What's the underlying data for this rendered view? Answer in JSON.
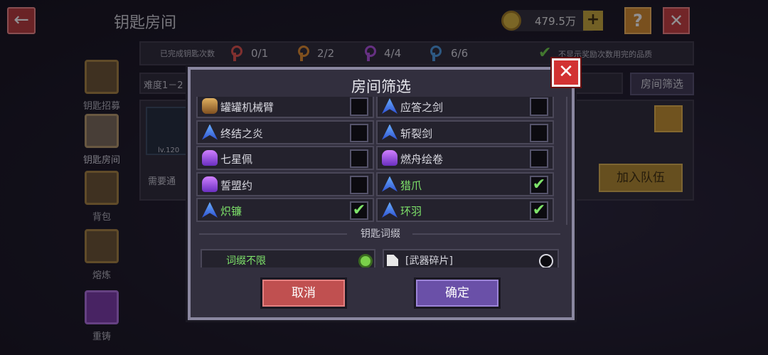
{
  "header": {
    "title": "钥匙房间",
    "currency": "479.5万"
  },
  "stats": {
    "completed_label": "已完成钥匙次数",
    "keys": [
      {
        "count": "0/1",
        "color": "#e0504a"
      },
      {
        "count": "2/2",
        "color": "#e08a2a"
      },
      {
        "count": "4/4",
        "color": "#b050e0"
      },
      {
        "count": "6/6",
        "color": "#4a9ae0"
      }
    ],
    "quality_label": "不显示奖励次数用完的品质"
  },
  "toolbar": {
    "difficulty": "难度1－2",
    "filter_button": "房间筛选"
  },
  "nav": [
    {
      "label": "钥匙招募"
    },
    {
      "label": "钥匙房间"
    },
    {
      "label": "背包"
    },
    {
      "label": "熔炼"
    },
    {
      "label": "重铸"
    }
  ],
  "room": {
    "level": "lv.120",
    "need": "需要通",
    "join_button": "加入队伍"
  },
  "modal": {
    "title": "房间筛选",
    "weapons": [
      {
        "name": "罐罐机械臂",
        "checked": false,
        "icon": "bronze"
      },
      {
        "name": "应答之剑",
        "checked": false,
        "icon": "blue"
      },
      {
        "name": "终结之炎",
        "checked": false,
        "icon": "blue"
      },
      {
        "name": "斩裂剑",
        "checked": false,
        "icon": "blue"
      },
      {
        "name": "七星佩",
        "checked": false,
        "icon": "purple"
      },
      {
        "name": "燃舟绘卷",
        "checked": false,
        "icon": "purple"
      },
      {
        "name": "誓盟约",
        "checked": false,
        "icon": "purple"
      },
      {
        "name": "猎爪",
        "checked": true,
        "icon": "blue"
      },
      {
        "name": "炽镰",
        "checked": true,
        "icon": "blue"
      },
      {
        "name": "环羽",
        "checked": true,
        "icon": "blue"
      }
    ],
    "section_label": "钥匙词缀",
    "suffixes": [
      {
        "label": "词缀不限",
        "selected": true
      },
      {
        "label": "[武器碎片]",
        "selected": false
      }
    ],
    "cancel_button": "取消",
    "confirm_button": "确定"
  }
}
